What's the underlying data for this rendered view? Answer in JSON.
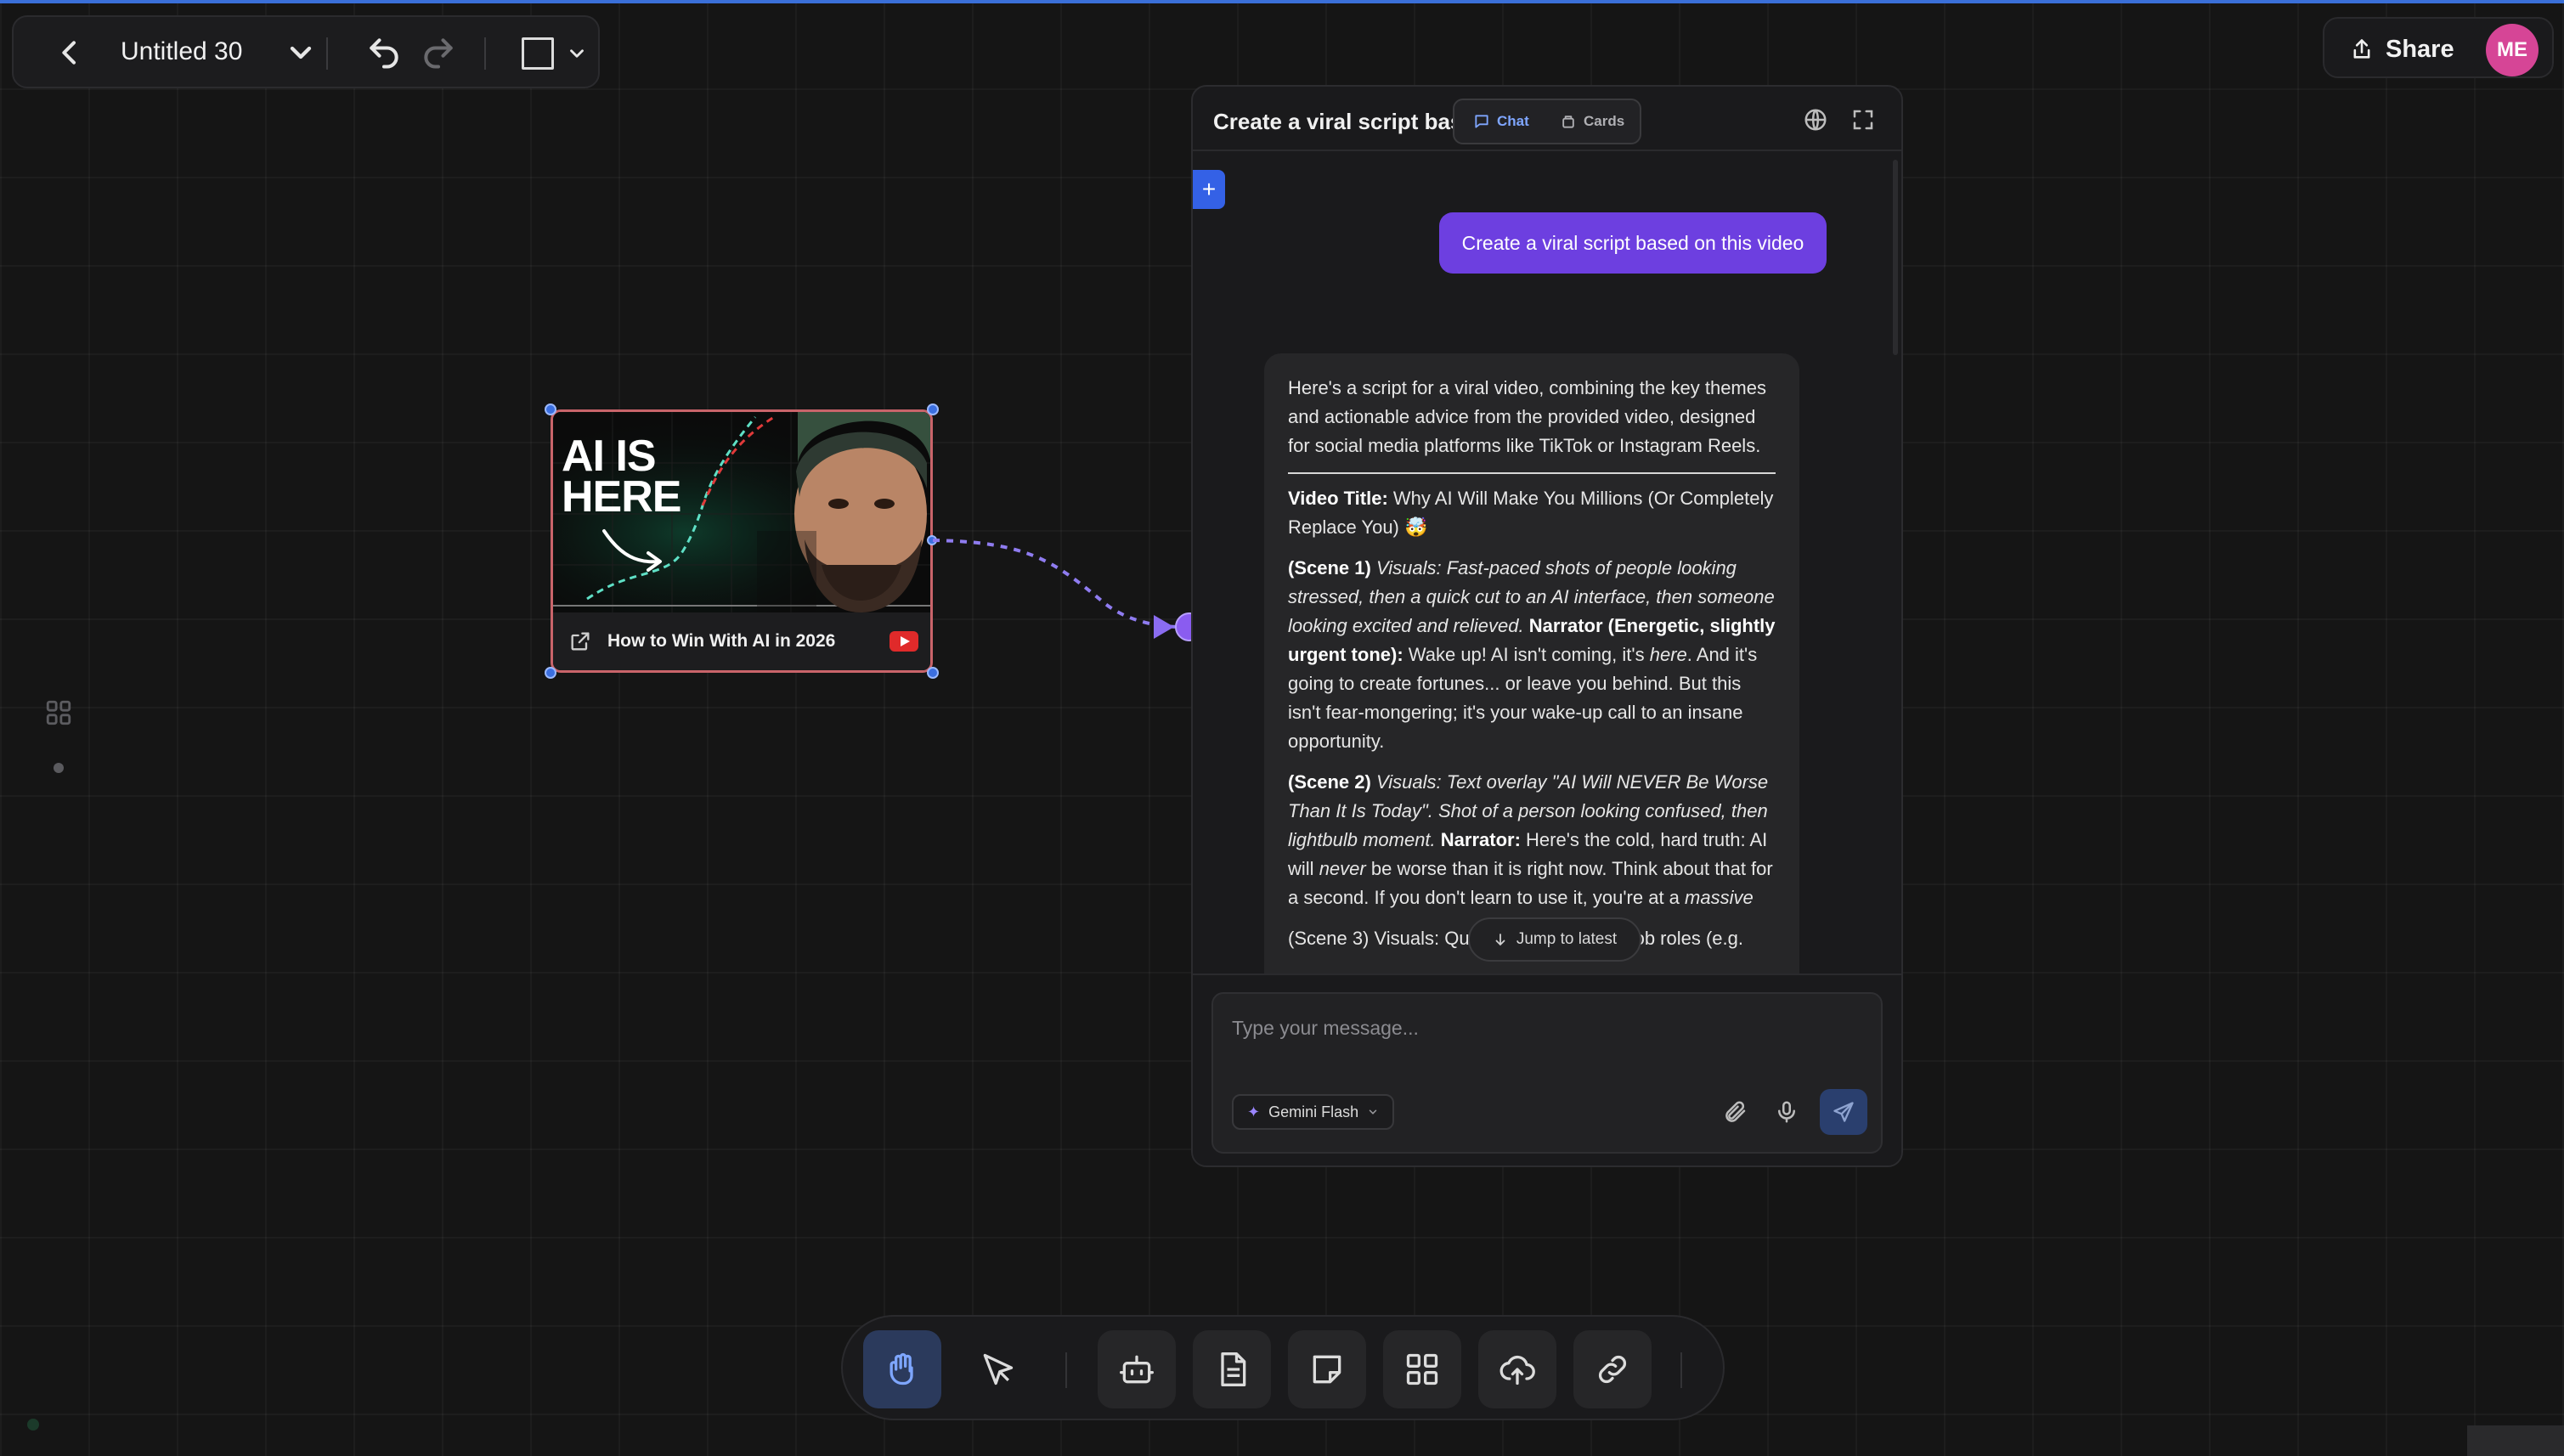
{
  "toolbar": {
    "title": "Untitled 30"
  },
  "topright": {
    "share_label": "Share",
    "avatar_initials": "ME",
    "avatar_color": "#d64596"
  },
  "video_node": {
    "thumbnail_text": "AI IS HERE",
    "title": "How to Win With AI in 2026",
    "border_color": "#c9646a"
  },
  "chat": {
    "title": "Create a viral script based on this video",
    "tabs": [
      {
        "label": "Chat",
        "active": true
      },
      {
        "label": "Cards",
        "active": false
      }
    ],
    "user_message": "Create a viral script based on this video",
    "ai": {
      "intro": "Here's a script for a viral video, combining the key themes and actionable advice from the provided video, designed for social media platforms like TikTok or Instagram Reels.",
      "video_title_label": "Video Title:",
      "video_title": "Why AI Will Make You Millions (Or Completely Replace You) 🤯",
      "scene1_label": "(Scene 1)",
      "scene1_visuals": "Visuals: Fast-paced shots of people looking stressed, then a quick cut to an AI interface, then someone looking excited and relieved.",
      "scene1_narrator_label": "Narrator (Energetic, slightly urgent tone):",
      "scene1_text_a": "Wake up! AI isn't coming, it's",
      "scene1_text_em": "here",
      "scene1_text_b": ". And it's going to create fortunes... or leave you behind. But this isn't fear-mongering; it's your wake-up call to an insane opportunity.",
      "scene2_label": "(Scene 2)",
      "scene2_visuals": "Visuals: Text overlay \"AI Will NEVER Be Worse Than It Is Today\". Shot of a person looking confused, then lightbulb moment.",
      "scene2_narrator_label": "Narrator:",
      "scene2_text_a": "Here's the cold, hard truth: AI will",
      "scene2_text_em": "never",
      "scene2_text_b": "be worse than it is right now. Think about that for a second. If you don't learn to use it, you're at a",
      "scene2_text_em2": "massive",
      "scene3_partial": "(Scene 3) Visuals: Quick cuts of different job roles (e.g."
    },
    "jump_label": "Jump to latest",
    "input_placeholder": "Type your message...",
    "model_label": "Gemini Flash"
  },
  "colors": {
    "accent_blue": "#3461e6",
    "user_bubble": "#6d3fe0",
    "active_tab": "#7fa6ff"
  }
}
